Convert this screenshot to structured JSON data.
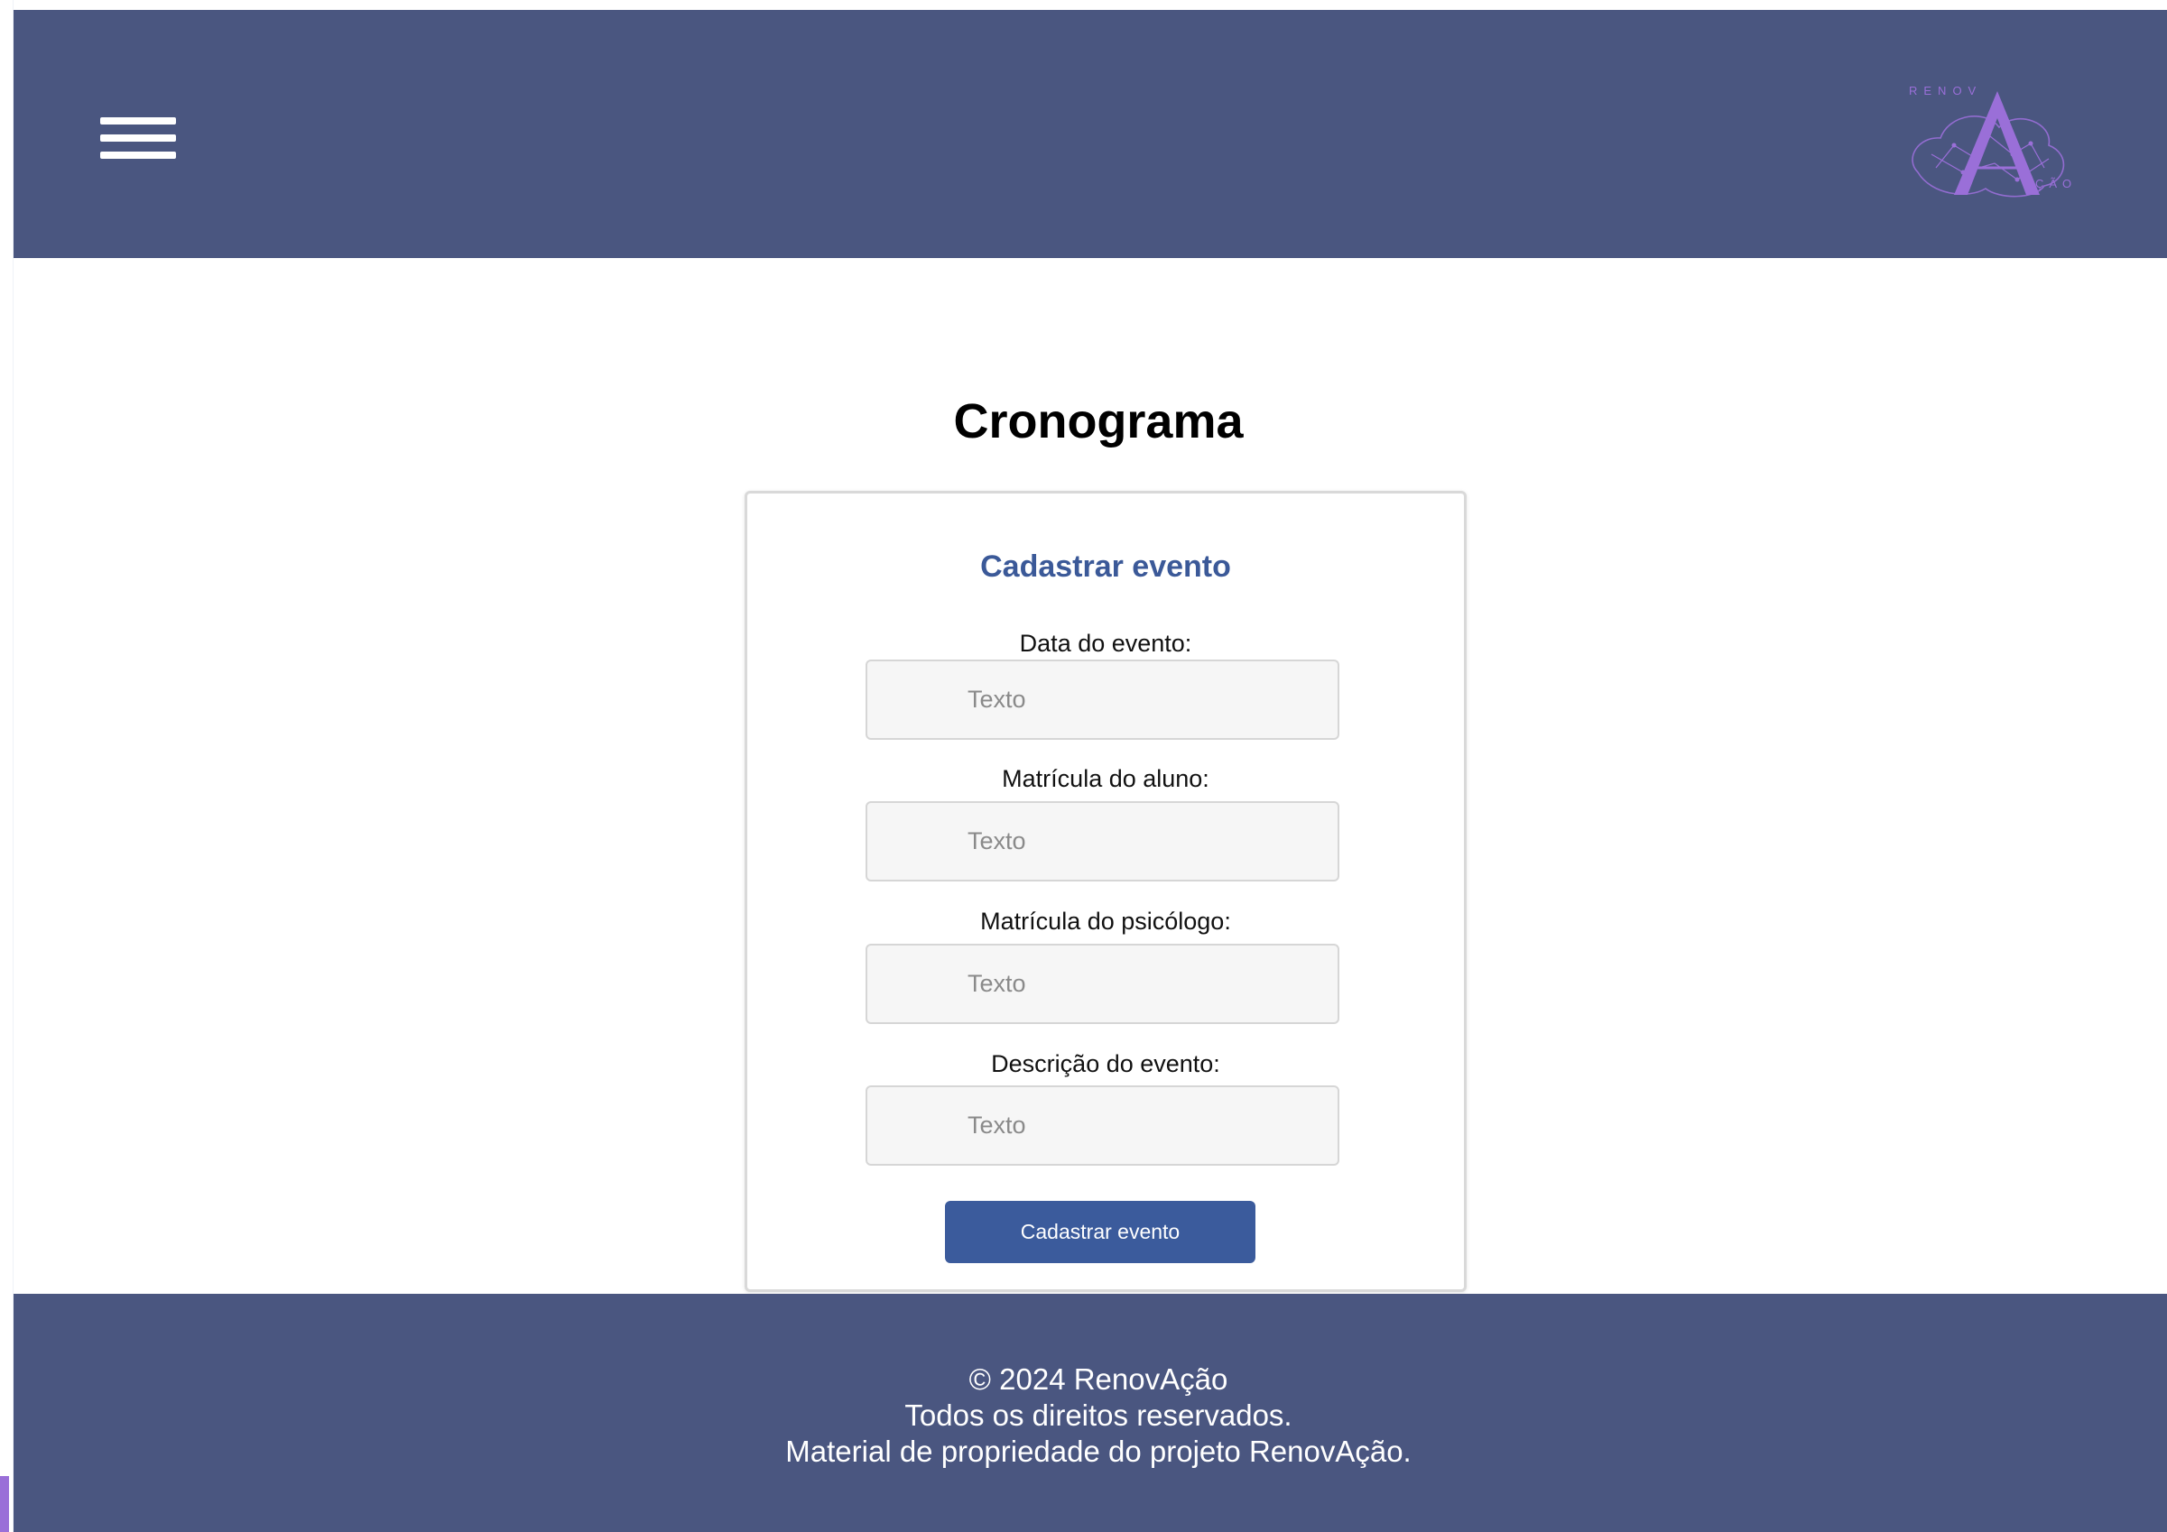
{
  "colors": {
    "header_bg": "#4a5680",
    "footer_bg": "#4a5680",
    "form_title": "#3b5998",
    "button_bg": "#3b5b9c",
    "logo_accent": "#9a6fd8"
  },
  "header": {
    "menu_icon": "hamburger-menu-icon",
    "logo": {
      "text_top": "RENOV",
      "text_bottom": "ÇÃO"
    }
  },
  "main": {
    "title": "Cronograma",
    "form": {
      "title": "Cadastrar evento",
      "fields": [
        {
          "label": "Data do evento:",
          "placeholder": "Texto",
          "value": ""
        },
        {
          "label": "Matrícula do aluno:",
          "placeholder": "Texto",
          "value": ""
        },
        {
          "label": "Matrícula do psicólogo:",
          "placeholder": "Texto",
          "value": ""
        },
        {
          "label": "Descrição do evento:",
          "placeholder": "Texto",
          "value": ""
        }
      ],
      "submit_label": "Cadastrar evento"
    }
  },
  "footer": {
    "lines": [
      "© 2024 RenovAção",
      "Todos os direitos reservados.",
      "Material de propriedade do projeto RenovAção."
    ]
  }
}
